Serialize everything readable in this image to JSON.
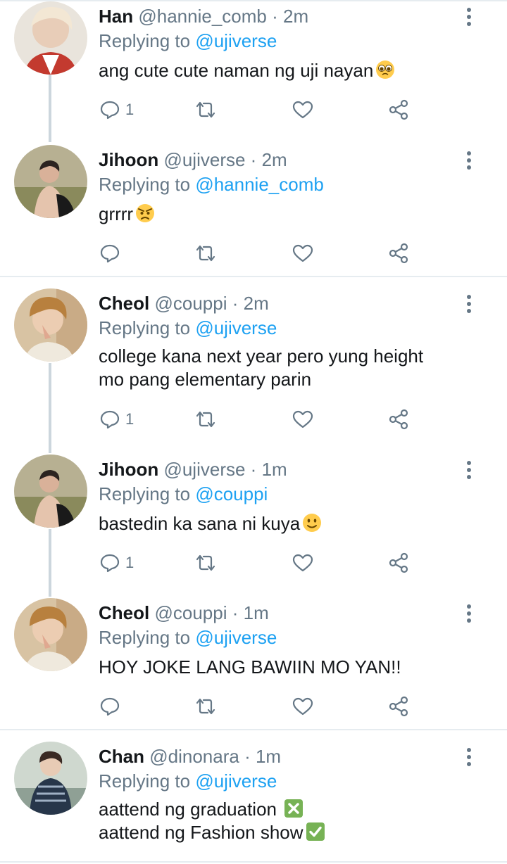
{
  "colors": {
    "link": "#1da1f2",
    "muted": "#657786",
    "text": "#14171a",
    "divider": "#e6ecf0"
  },
  "icons": {
    "reply": "reply-icon",
    "retweet": "retweet-icon",
    "like": "heart-icon",
    "share": "share-icon",
    "menu": "more-vertical-icon"
  },
  "tweets": [
    {
      "name": "Han",
      "handle": "@hannie_comb",
      "time": "2m",
      "reply_label": "Replying to",
      "reply_to": "@ujiverse",
      "lines": [
        "ang cute cute naman ng uji nayan"
      ],
      "emoji": "pleading-face-emoji",
      "reply_count": "1"
    },
    {
      "name": "Jihoon",
      "handle": "@ujiverse",
      "time": "2m",
      "reply_label": "Replying to",
      "reply_to": "@hannie_comb",
      "lines": [
        "grrrr"
      ],
      "emoji": "angry-face-emoji",
      "reply_count": ""
    },
    {
      "name": "Cheol",
      "handle": "@couppi",
      "time": "2m",
      "reply_label": "Replying to",
      "reply_to": "@ujiverse",
      "lines": [
        "college kana next year pero yung height",
        "mo pang elementary parin"
      ],
      "reply_count": "1"
    },
    {
      "name": "Jihoon",
      "handle": "@ujiverse",
      "time": "1m",
      "reply_label": "Replying to",
      "reply_to": "@couppi",
      "lines": [
        "bastedin ka sana ni kuya"
      ],
      "emoji": "slightly-smiling-face-emoji",
      "reply_count": "1"
    },
    {
      "name": "Cheol",
      "handle": "@couppi",
      "time": "1m",
      "reply_label": "Replying to",
      "reply_to": "@ujiverse",
      "lines": [
        "HOY JOKE LANG BAWIIN MO YAN!!"
      ],
      "reply_count": ""
    },
    {
      "name": "Chan",
      "handle": "@dinonara",
      "time": "1m",
      "reply_label": "Replying to",
      "reply_to": "@ujiverse",
      "lines": [
        "aattend ng graduation ",
        "aattend ng Fashion show"
      ],
      "line_emojis": [
        "cross-mark-emoji",
        "check-mark-emoji"
      ],
      "reply_count": ""
    }
  ],
  "separator": "·"
}
